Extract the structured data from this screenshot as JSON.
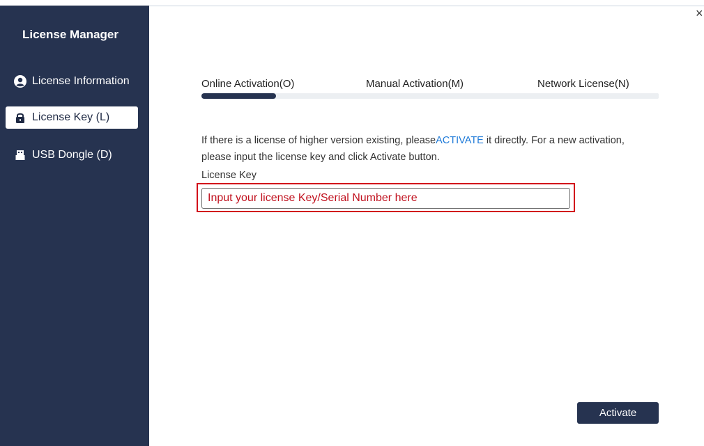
{
  "sidebar": {
    "title": "License Manager",
    "items": [
      {
        "label": "License Information",
        "icon": "user-icon"
      },
      {
        "label": "License Key (L)",
        "icon": "lock-icon",
        "active": true
      },
      {
        "label": "USB Dongle (D)",
        "icon": "usb-icon"
      }
    ]
  },
  "window": {
    "close_symbol": "×"
  },
  "tabs": [
    {
      "label": "Online Activation(O)",
      "active": true
    },
    {
      "label": "Manual Activation(M)"
    },
    {
      "label": "Network License(N)"
    }
  ],
  "content": {
    "desc_before": "If there is a license of higher version existing, please",
    "desc_link": "ACTIVATE",
    "desc_after": " it directly. For a new activation, please input the license key and click Activate button.",
    "license_label": "License Key",
    "input_placeholder": "Input your license Key/Serial Number here",
    "activate_label": "Activate"
  },
  "colors": {
    "sidebar": "#263350",
    "accent_link": "#1f7ad8",
    "highlight_red": "#d20f1a"
  }
}
